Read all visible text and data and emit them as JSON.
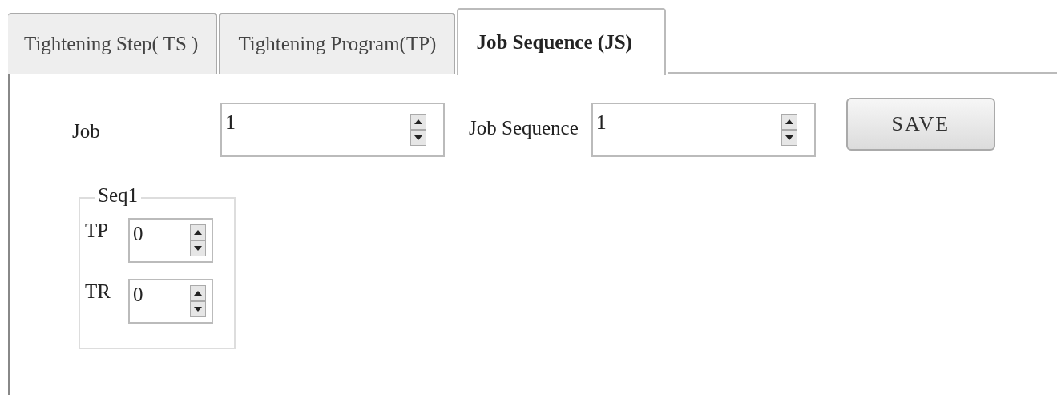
{
  "tabs": [
    {
      "label": "Tightening Step( TS )",
      "selected": false
    },
    {
      "label": "Tightening Program(TP)",
      "selected": false
    },
    {
      "label": "Job Sequence (JS)",
      "selected": true
    }
  ],
  "job": {
    "label": "Job",
    "value": "1"
  },
  "job_sequence": {
    "label": "Job Sequence",
    "value": "1"
  },
  "save_button": "SAVE",
  "group": {
    "title": "Seq1",
    "fields": [
      {
        "label": "TP",
        "value": "0"
      },
      {
        "label": "TR",
        "value": "0"
      }
    ]
  }
}
